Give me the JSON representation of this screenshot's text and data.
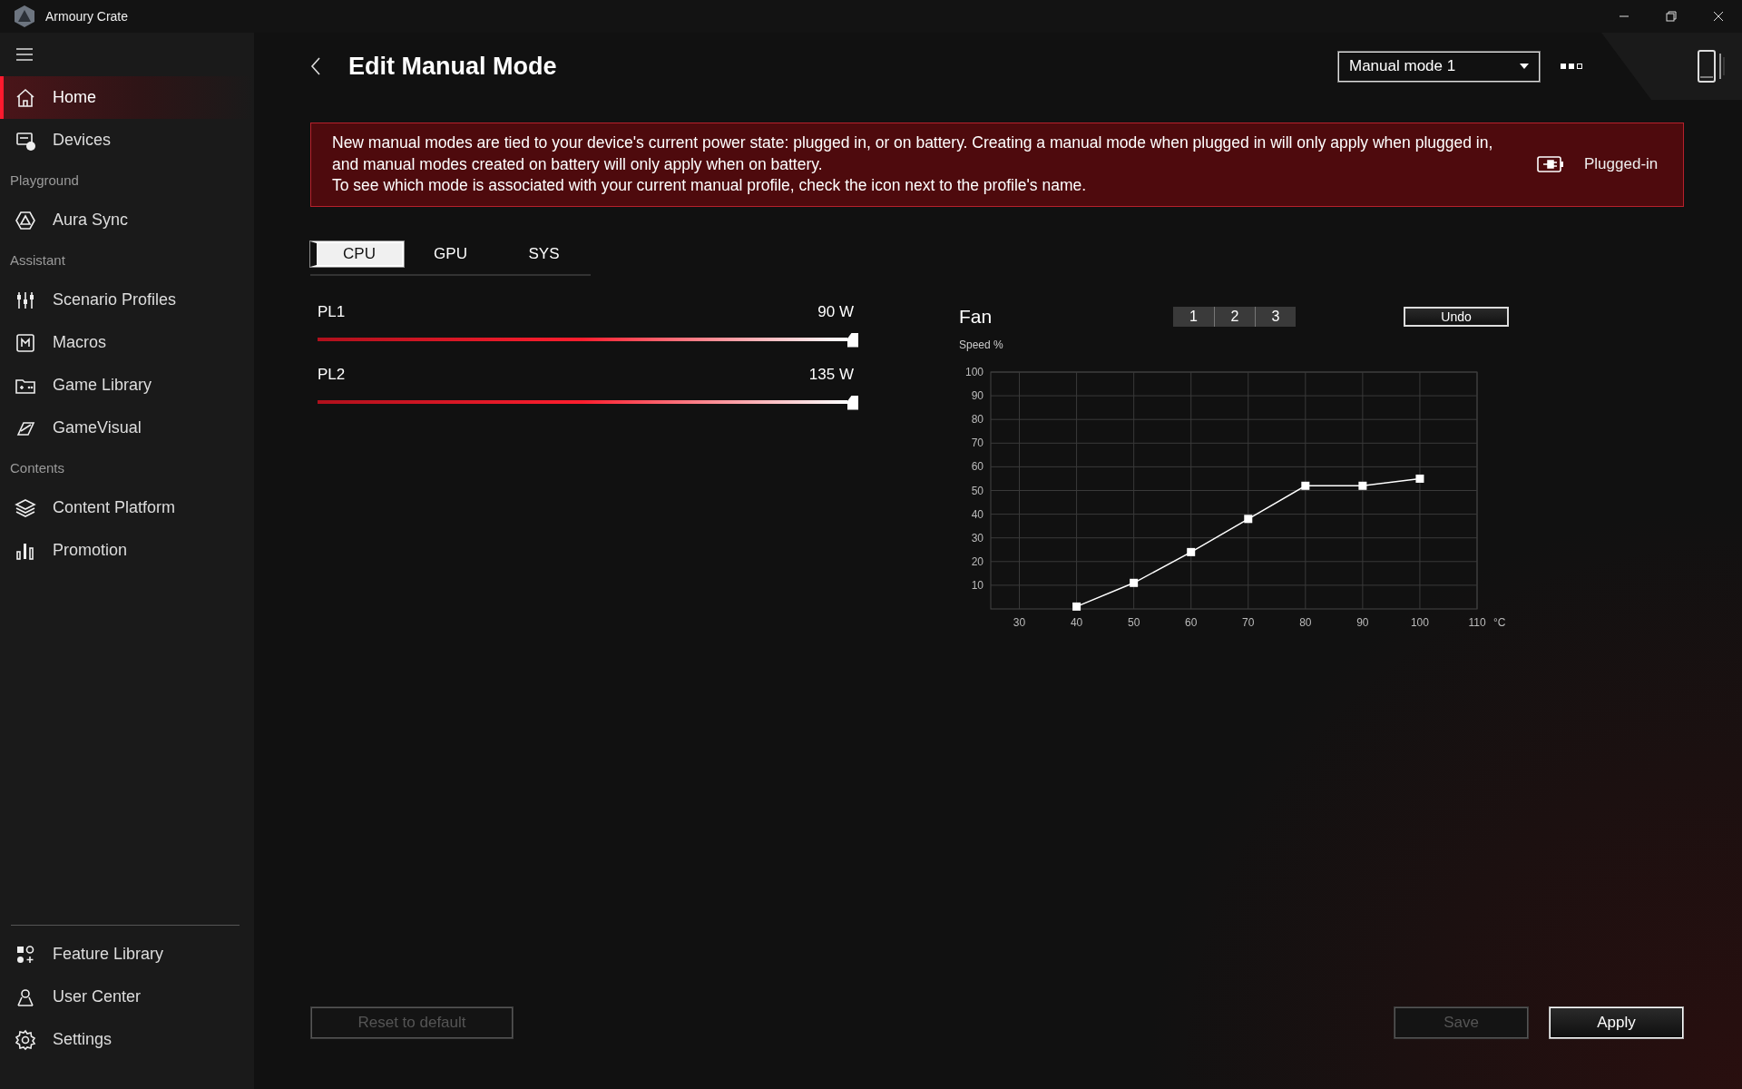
{
  "window": {
    "title": "Armoury Crate"
  },
  "sidebar": {
    "items": [
      {
        "kind": "item",
        "label": "Home",
        "selected": true
      },
      {
        "kind": "item",
        "label": "Devices",
        "selected": false
      },
      {
        "kind": "section",
        "label": "Playground"
      },
      {
        "kind": "item",
        "label": "Aura Sync",
        "selected": false
      },
      {
        "kind": "section",
        "label": "Assistant"
      },
      {
        "kind": "item",
        "label": "Scenario Profiles",
        "selected": false
      },
      {
        "kind": "item",
        "label": "Macros",
        "selected": false
      },
      {
        "kind": "item",
        "label": "Game Library",
        "selected": false
      },
      {
        "kind": "item",
        "label": "GameVisual",
        "selected": false
      },
      {
        "kind": "section",
        "label": "Contents"
      },
      {
        "kind": "item",
        "label": "Content Platform",
        "selected": false
      },
      {
        "kind": "item",
        "label": "Promotion",
        "selected": false
      }
    ],
    "bottom_items": [
      {
        "label": "Feature Library"
      },
      {
        "label": "User Center"
      },
      {
        "label": "Settings"
      }
    ]
  },
  "header": {
    "title": "Edit Manual Mode",
    "mode_dropdown": {
      "value": "Manual mode 1"
    }
  },
  "banner": {
    "lines": [
      "New manual modes are tied to your device's current power state: plugged in, or on battery. Creating a manual mode when plugged in will only apply when plugged in, and manual modes created on battery will only apply when on battery.",
      "To see which mode is associated with your current manual profile, check the icon next to the profile's name."
    ],
    "power_state": "Plugged-in"
  },
  "tabs": [
    {
      "label": "CPU",
      "selected": true
    },
    {
      "label": "GPU",
      "selected": false
    },
    {
      "label": "SYS",
      "selected": false
    }
  ],
  "power_limits": [
    {
      "name": "PL1",
      "reading": "90 W",
      "level": 1
    },
    {
      "name": "PL2",
      "reading": "135 W",
      "level": 1
    }
  ],
  "fan": {
    "title": "Fan",
    "fan_buttons": [
      "1",
      "2",
      "3"
    ],
    "undo": "Undo",
    "chart_data": {
      "type": "line",
      "ylabel": "Speed %",
      "xlabel": "°C",
      "x": [
        40,
        50,
        60,
        70,
        80,
        90,
        100
      ],
      "series": [
        {
          "color": "#ffffff",
          "marker": "square",
          "values": [
            1,
            11,
            24,
            38,
            52,
            52,
            55
          ]
        }
      ],
      "grid": true,
      "xlim": [
        25,
        110
      ],
      "ylim": [
        0,
        100
      ],
      "xticks": [
        30,
        40,
        50,
        60,
        70,
        80,
        90,
        100,
        110
      ],
      "yticks": [
        10,
        20,
        30,
        40,
        50,
        60,
        70,
        80,
        90,
        100
      ]
    }
  },
  "footer": {
    "left_buttons": [
      {
        "label": "Reset to default",
        "disabled": true
      }
    ],
    "right_buttons": [
      {
        "label": "Save",
        "disabled": true
      },
      {
        "label": "Apply",
        "disabled": false
      }
    ]
  }
}
